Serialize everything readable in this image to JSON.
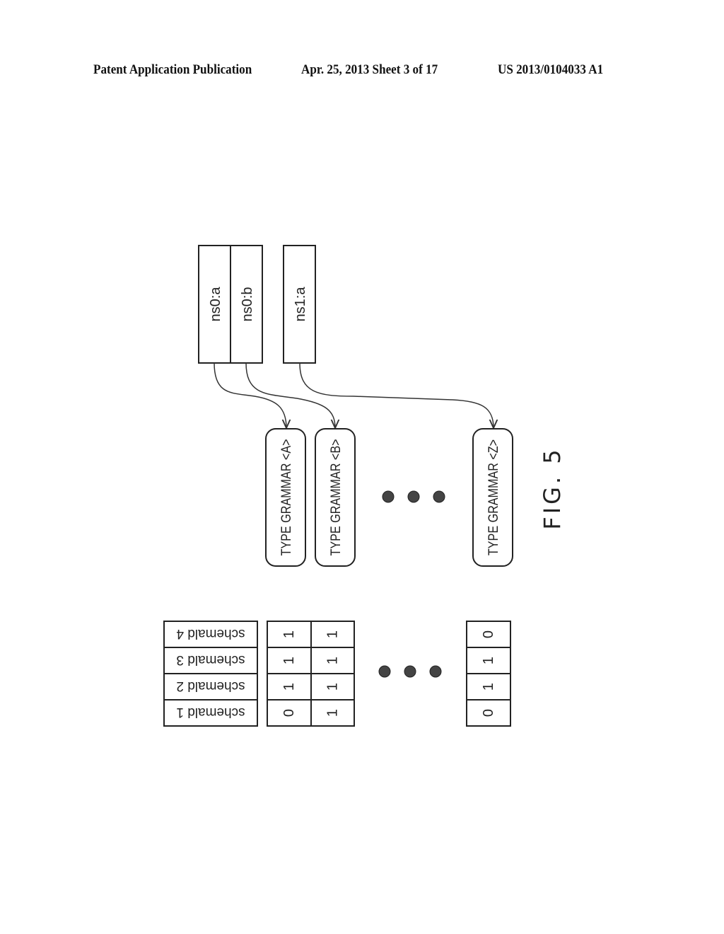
{
  "header": {
    "publication": "Patent Application Publication",
    "date_sheet": "Apr. 25, 2013  Sheet 3 of 17",
    "patent_number": "US 2013/0104033 A1"
  },
  "figure": {
    "label": "FIG. 5",
    "element_names": [
      {
        "id": "ns0a",
        "label": "ns0:a",
        "group": 0
      },
      {
        "id": "ns0b",
        "label": "ns0:b",
        "group": 0
      },
      {
        "id": "ns1a",
        "label": "ns1:a",
        "group": 1
      }
    ],
    "type_grammars": [
      {
        "id": "A",
        "label": "TYPE GRAMMAR <A>"
      },
      {
        "id": "B",
        "label": "TYPE GRAMMAR <B>"
      },
      {
        "id": "Z",
        "label": "TYPE GRAMMAR <Z>"
      }
    ],
    "mappings": [
      {
        "from": "ns0:a",
        "to": "TYPE GRAMMAR <A>"
      },
      {
        "from": "ns0:b",
        "to": "TYPE GRAMMAR <B>"
      },
      {
        "from": "ns1:a",
        "to": "TYPE GRAMMAR <Z>"
      }
    ],
    "ellipsis": "● ● ●",
    "schema_ids": [
      "schemaId 1",
      "schemaId 2",
      "schemaId 3",
      "schemaId 4"
    ],
    "schema_ids_displayed": [
      "schemald 1",
      "schemald 2",
      "schemald 3",
      "schemald 4"
    ],
    "bit_vectors": [
      {
        "grammar": "A",
        "bits": [
          "0",
          "1",
          "1",
          "1"
        ]
      },
      {
        "grammar": "B",
        "bits": [
          "1",
          "1",
          "1",
          "1"
        ]
      },
      {
        "grammar": "Z",
        "bits": [
          "0",
          "1",
          "1",
          "0"
        ]
      }
    ]
  }
}
